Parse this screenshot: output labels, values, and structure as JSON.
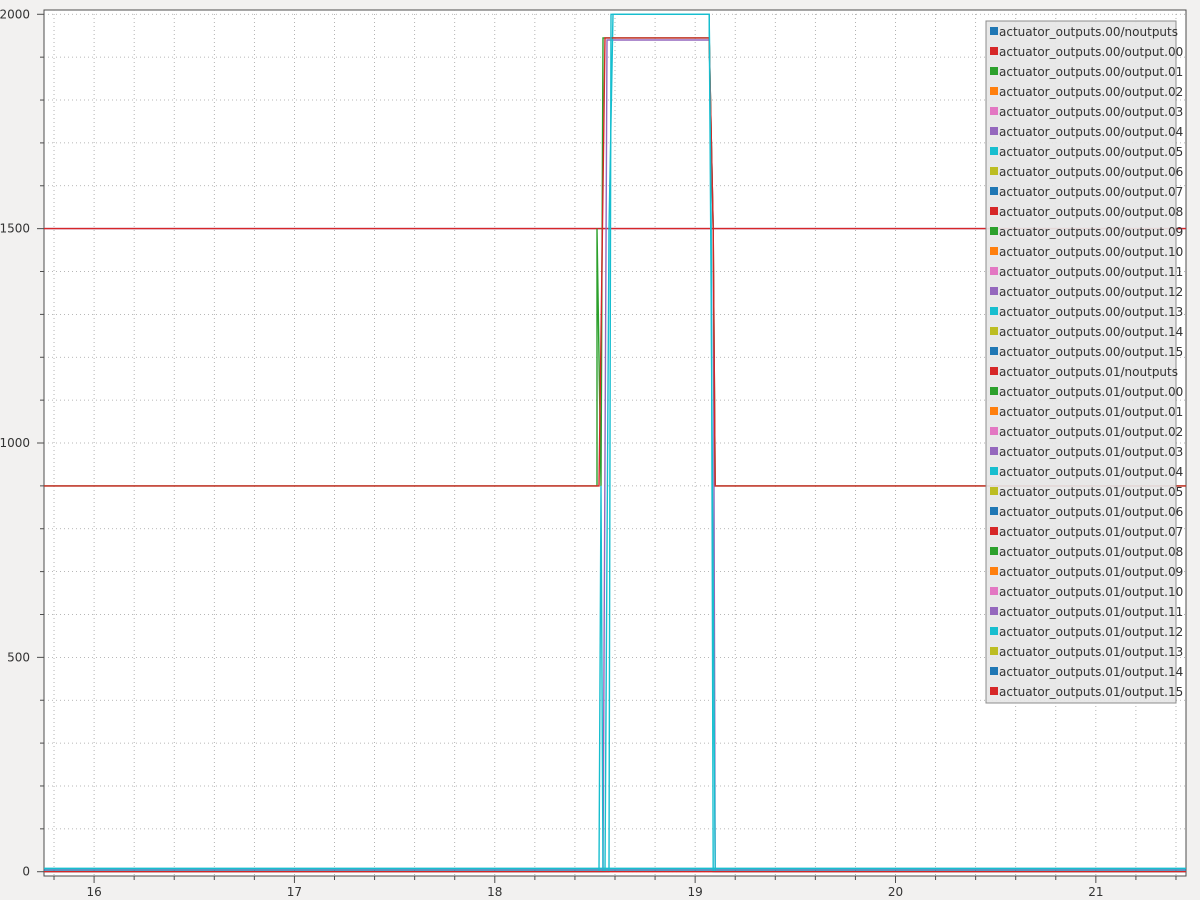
{
  "chart_data": {
    "type": "line",
    "xlim": [
      15.75,
      21.45
    ],
    "ylim": [
      -10,
      2010
    ],
    "x_ticks": [
      16,
      17,
      18,
      19,
      20,
      21
    ],
    "x_tick_labels": [
      "16",
      "17",
      "18",
      "19",
      "20",
      "21"
    ],
    "y_ticks": [
      0,
      500,
      1000,
      1500,
      2000
    ],
    "y_tick_labels": [
      "0",
      "500",
      "1000",
      "1500",
      "2000"
    ],
    "grid": true,
    "legend_position": "top-right",
    "legend": [
      {
        "label": "actuator_outputs.00/noutputs",
        "color": "#1f77b4"
      },
      {
        "label": "actuator_outputs.00/output.00",
        "color": "#d62728"
      },
      {
        "label": "actuator_outputs.00/output.01",
        "color": "#2ca02c"
      },
      {
        "label": "actuator_outputs.00/output.02",
        "color": "#ff7f0e"
      },
      {
        "label": "actuator_outputs.00/output.03",
        "color": "#e377c2"
      },
      {
        "label": "actuator_outputs.00/output.04",
        "color": "#9467bd"
      },
      {
        "label": "actuator_outputs.00/output.05",
        "color": "#17becf"
      },
      {
        "label": "actuator_outputs.00/output.06",
        "color": "#bcbd22"
      },
      {
        "label": "actuator_outputs.00/output.07",
        "color": "#1f77b4"
      },
      {
        "label": "actuator_outputs.00/output.08",
        "color": "#d62728"
      },
      {
        "label": "actuator_outputs.00/output.09",
        "color": "#2ca02c"
      },
      {
        "label": "actuator_outputs.00/output.10",
        "color": "#ff7f0e"
      },
      {
        "label": "actuator_outputs.00/output.11",
        "color": "#e377c2"
      },
      {
        "label": "actuator_outputs.00/output.12",
        "color": "#9467bd"
      },
      {
        "label": "actuator_outputs.00/output.13",
        "color": "#17becf"
      },
      {
        "label": "actuator_outputs.00/output.14",
        "color": "#bcbd22"
      },
      {
        "label": "actuator_outputs.00/output.15",
        "color": "#1f77b4"
      },
      {
        "label": "actuator_outputs.01/noutputs",
        "color": "#d62728"
      },
      {
        "label": "actuator_outputs.01/output.00",
        "color": "#2ca02c"
      },
      {
        "label": "actuator_outputs.01/output.01",
        "color": "#ff7f0e"
      },
      {
        "label": "actuator_outputs.01/output.02",
        "color": "#e377c2"
      },
      {
        "label": "actuator_outputs.01/output.03",
        "color": "#9467bd"
      },
      {
        "label": "actuator_outputs.01/output.04",
        "color": "#17becf"
      },
      {
        "label": "actuator_outputs.01/output.05",
        "color": "#bcbd22"
      },
      {
        "label": "actuator_outputs.01/output.06",
        "color": "#1f77b4"
      },
      {
        "label": "actuator_outputs.01/output.07",
        "color": "#d62728"
      },
      {
        "label": "actuator_outputs.01/output.08",
        "color": "#2ca02c"
      },
      {
        "label": "actuator_outputs.01/output.09",
        "color": "#ff7f0e"
      },
      {
        "label": "actuator_outputs.01/output.10",
        "color": "#e377c2"
      },
      {
        "label": "actuator_outputs.01/output.11",
        "color": "#9467bd"
      },
      {
        "label": "actuator_outputs.01/output.12",
        "color": "#17becf"
      },
      {
        "label": "actuator_outputs.01/output.13",
        "color": "#bcbd22"
      },
      {
        "label": "actuator_outputs.01/output.14",
        "color": "#1f77b4"
      },
      {
        "label": "actuator_outputs.01/output.15",
        "color": "#d62728"
      }
    ],
    "series": [
      {
        "color": "#9467bd",
        "x": [
          15.75,
          21.45
        ],
        "y": [
          1500,
          1500
        ]
      },
      {
        "color": "#d62728",
        "x": [
          15.75,
          21.45
        ],
        "y": [
          1500,
          1500
        ]
      },
      {
        "color": "#17becf",
        "x": [
          15.75,
          21.45
        ],
        "y": [
          8,
          8
        ]
      },
      {
        "color": "#1f77b4",
        "x": [
          15.75,
          21.45
        ],
        "y": [
          4,
          4
        ]
      },
      {
        "color": "#9467bd",
        "x": [
          15.75,
          18.52,
          18.54,
          18.56,
          18.6,
          19.07,
          19.09,
          19.1,
          21.45
        ],
        "y": [
          0,
          0,
          0,
          1940,
          1940,
          1940,
          1500,
          0,
          0
        ]
      },
      {
        "color": "#17becf",
        "x": [
          15.75,
          18.53,
          18.55,
          18.57,
          18.59,
          19.07,
          19.1,
          21.45
        ],
        "y": [
          0,
          0,
          0,
          1500,
          2000,
          2000,
          0,
          0
        ]
      },
      {
        "color": "#2ca02c",
        "x": [
          15.75,
          18.51,
          18.51,
          18.53,
          18.54,
          19.07,
          19.09,
          19.1,
          21.45
        ],
        "y": [
          900,
          900,
          1500,
          900,
          1945,
          1945,
          1500,
          900,
          900
        ]
      },
      {
        "color": "#d62728",
        "x": [
          15.75,
          18.52,
          18.55,
          19.07,
          19.09,
          19.1,
          21.45
        ],
        "y": [
          900,
          900,
          1945,
          1945,
          1500,
          900,
          900
        ]
      },
      {
        "color": "#17becf",
        "x": [
          15.75,
          18.52,
          18.53,
          18.54,
          18.55,
          18.57,
          18.58,
          19.07,
          19.08,
          19.09,
          19.1,
          21.45
        ],
        "y": [
          0,
          0,
          900,
          0,
          0,
          0,
          2000,
          2000,
          1500,
          0,
          0,
          0
        ]
      },
      {
        "color": "#d62728",
        "x": [
          15.75,
          21.45
        ],
        "y": [
          0,
          0
        ]
      }
    ]
  }
}
